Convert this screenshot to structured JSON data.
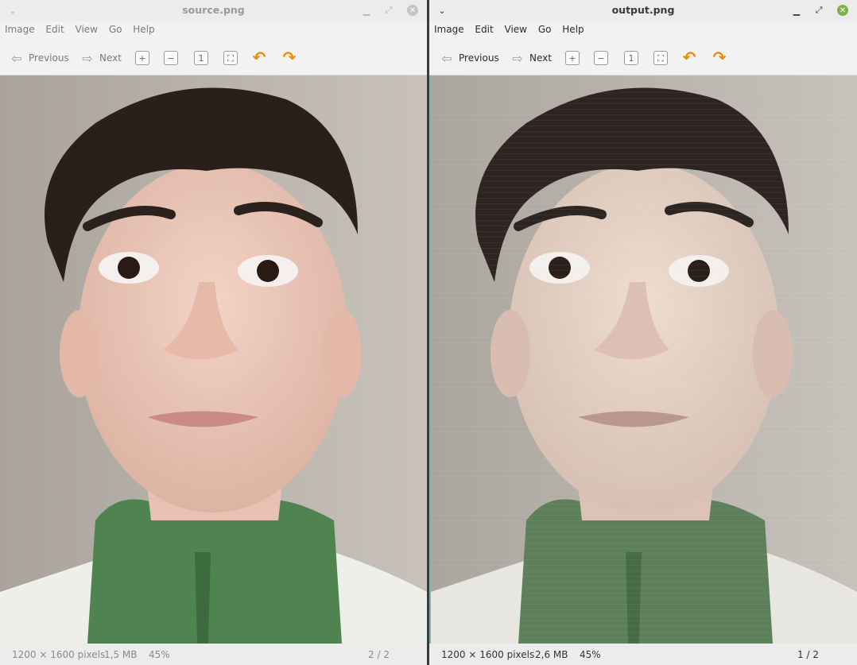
{
  "windows": [
    {
      "title": "source.png",
      "menu": [
        "Image",
        "Edit",
        "View",
        "Go",
        "Help"
      ],
      "toolbar": {
        "previous_label": "Previous",
        "next_label": "Next"
      },
      "status": {
        "dimensions": "1200 × 1600 pixels",
        "size": "1,5 MB",
        "zoom": "45%",
        "page": "2 / 2"
      },
      "focused": false,
      "close_color": "#c4c4c4"
    },
    {
      "title": "output.png",
      "menu": [
        "Image",
        "Edit",
        "View",
        "Go",
        "Help"
      ],
      "toolbar": {
        "previous_label": "Previous",
        "next_label": "Next"
      },
      "status": {
        "dimensions": "1200 × 1600 pixels",
        "size": "2,6 MB",
        "zoom": "45%",
        "page": "1 / 2"
      },
      "focused": true,
      "close_color": "#7bb24a"
    }
  ],
  "icons": {
    "window_menu": "chevron-down-icon",
    "minimize": "minimize-icon",
    "maximize": "maximize-icon",
    "close": "close-icon",
    "previous": "arrow-left-icon",
    "next": "arrow-right-icon",
    "zoom_in": "zoom-in-icon",
    "zoom_out": "zoom-out-icon",
    "zoom_normal": "zoom-normal-icon",
    "zoom_fit": "zoom-fit-icon",
    "rotate_left": "rotate-left-icon",
    "rotate_right": "rotate-right-icon"
  },
  "colors": {
    "rotate_accent": "#f08a00"
  }
}
